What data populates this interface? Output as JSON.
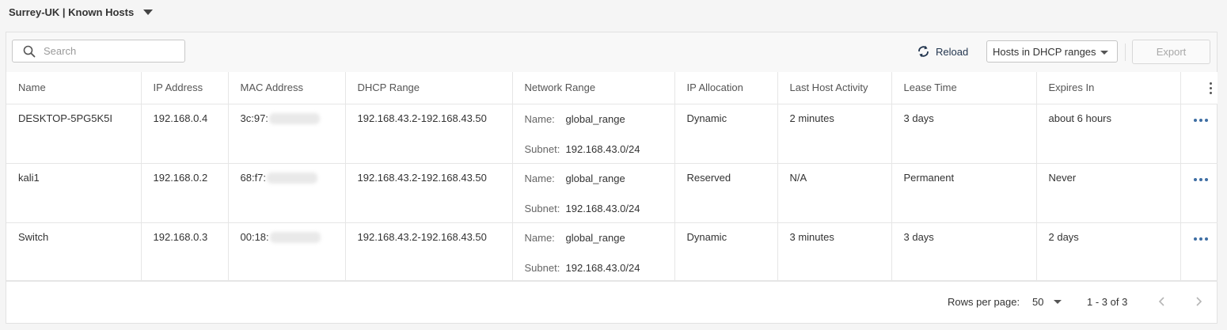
{
  "header": {
    "title": "Surrey-UK | Known Hosts"
  },
  "toolbar": {
    "search_placeholder": "Search",
    "reload_label": "Reload",
    "filter_value": "Hosts in DHCP ranges",
    "export_label": "Export"
  },
  "table": {
    "columns": [
      "Name",
      "IP Address",
      "MAC Address",
      "DHCP Range",
      "Network Range",
      "IP Allocation",
      "Last Host Activity",
      "Lease Time",
      "Expires In"
    ],
    "network_name_key": "Name:",
    "network_subnet_key": "Subnet:",
    "rows": [
      {
        "name": "DESKTOP-5PG5K5I",
        "ip": "192.168.0.4",
        "mac_prefix": "3c:97:",
        "dhcp_range": "192.168.43.2-192.168.43.50",
        "network_name": "global_range",
        "network_subnet": "192.168.43.0/24",
        "allocation": "Dynamic",
        "last_activity": "2 minutes",
        "lease_time": "3 days",
        "expires_in": "about 6 hours"
      },
      {
        "name": "kali1",
        "ip": "192.168.0.2",
        "mac_prefix": "68:f7:",
        "dhcp_range": "192.168.43.2-192.168.43.50",
        "network_name": "global_range",
        "network_subnet": "192.168.43.0/24",
        "allocation": "Reserved",
        "last_activity": "N/A",
        "lease_time": "Permanent",
        "expires_in": "Never"
      },
      {
        "name": "Switch",
        "ip": "192.168.0.3",
        "mac_prefix": "00:18:",
        "dhcp_range": "192.168.43.2-192.168.43.50",
        "network_name": "global_range",
        "network_subnet": "192.168.43.0/24",
        "allocation": "Dynamic",
        "last_activity": "3 minutes",
        "lease_time": "3 days",
        "expires_in": "2 days"
      }
    ]
  },
  "footer": {
    "rows_per_page_label": "Rows per page:",
    "rows_per_page_value": "50",
    "range_text": "1 - 3 of 3"
  },
  "colors": {
    "accent": "#3e6ea3",
    "reload": "#23364f"
  }
}
